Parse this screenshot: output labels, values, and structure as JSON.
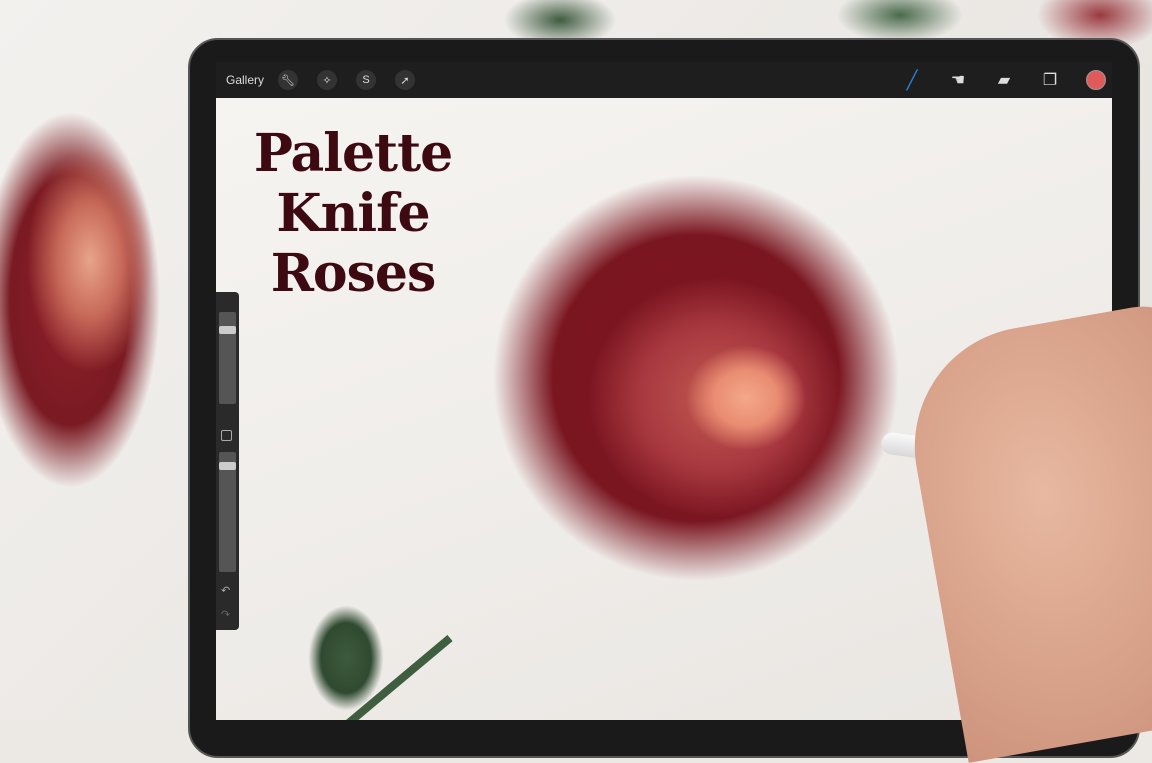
{
  "toolbar": {
    "gallery": "Gallery",
    "left_icons": [
      "wrench-icon",
      "magic-wand-icon",
      "selection-icon",
      "arrow-icon"
    ],
    "right_icons": [
      "brush-icon",
      "smudge-icon",
      "eraser-icon",
      "layers-icon"
    ],
    "current_color": "#e05a5a",
    "brush_color": "#2a7fd8"
  },
  "title": {
    "line1": "Palette",
    "line2": "Knife",
    "line3": "Roses"
  },
  "sidebar": {
    "undo": "↶",
    "redo": "↷"
  }
}
